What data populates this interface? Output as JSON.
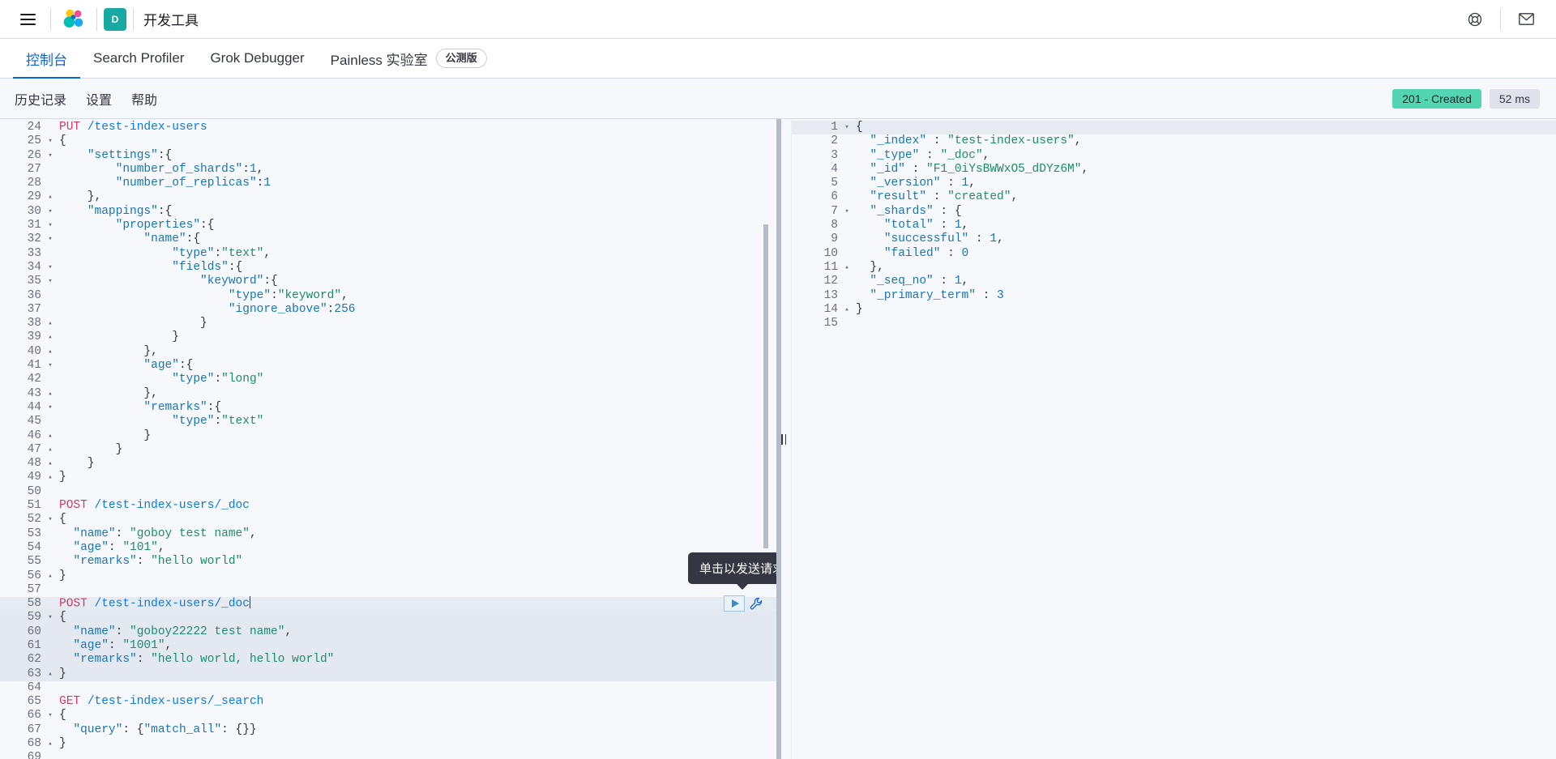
{
  "header": {
    "menu_icon": "hamburger-menu-icon",
    "logo_icon": "elastic-logo-icon",
    "space_avatar_label": "D",
    "app_title": "开发工具",
    "help_icon": "help-lifering-icon",
    "mail_icon": "mail-envelope-icon"
  },
  "app_tabs": [
    {
      "label": "控制台",
      "active": true
    },
    {
      "label": "Search Profiler",
      "active": false
    },
    {
      "label": "Grok Debugger",
      "active": false
    },
    {
      "label": "Painless 实验室",
      "active": false,
      "badge": "公测版"
    }
  ],
  "console_toolbar": {
    "links": [
      {
        "label": "历史记录"
      },
      {
        "label": "设置"
      },
      {
        "label": "帮助"
      }
    ],
    "status_badge": "201 - Created",
    "time_badge": "52 ms",
    "status_color": "#54d5b2",
    "time_color": "#dfe2ea"
  },
  "tooltip": {
    "text": "单击以发送请求"
  },
  "run_action": {
    "play_icon": "play-triangle-icon",
    "wrench_icon": "wrench-icon"
  },
  "editor": {
    "first_visible_line": 24,
    "lines": [
      {
        "n": 24,
        "fold": "",
        "tokens": [
          {
            "t": "PUT ",
            "c": "kw-method"
          },
          {
            "t": "/test-index-users",
            "c": "kw-url"
          }
        ]
      },
      {
        "n": 25,
        "fold": "▾",
        "tokens": [
          {
            "t": "{",
            "c": "punc"
          }
        ]
      },
      {
        "n": 26,
        "fold": "▾",
        "tokens": [
          {
            "t": "    ",
            "c": "plain"
          },
          {
            "t": "\"settings\"",
            "c": "key"
          },
          {
            "t": ":{",
            "c": "punc"
          }
        ]
      },
      {
        "n": 27,
        "fold": "",
        "tokens": [
          {
            "t": "        ",
            "c": "plain"
          },
          {
            "t": "\"number_of_shards\"",
            "c": "key"
          },
          {
            "t": ":",
            "c": "punc"
          },
          {
            "t": "1",
            "c": "num"
          },
          {
            "t": ",",
            "c": "punc"
          }
        ]
      },
      {
        "n": 28,
        "fold": "",
        "tokens": [
          {
            "t": "        ",
            "c": "plain"
          },
          {
            "t": "\"number_of_replicas\"",
            "c": "key"
          },
          {
            "t": ":",
            "c": "punc"
          },
          {
            "t": "1",
            "c": "num"
          }
        ]
      },
      {
        "n": 29,
        "fold": "▴",
        "tokens": [
          {
            "t": "    },",
            "c": "punc"
          }
        ]
      },
      {
        "n": 30,
        "fold": "▾",
        "tokens": [
          {
            "t": "    ",
            "c": "plain"
          },
          {
            "t": "\"mappings\"",
            "c": "key"
          },
          {
            "t": ":{",
            "c": "punc"
          }
        ]
      },
      {
        "n": 31,
        "fold": "▾",
        "tokens": [
          {
            "t": "        ",
            "c": "plain"
          },
          {
            "t": "\"properties\"",
            "c": "key"
          },
          {
            "t": ":{",
            "c": "punc"
          }
        ]
      },
      {
        "n": 32,
        "fold": "▾",
        "tokens": [
          {
            "t": "            ",
            "c": "plain"
          },
          {
            "t": "\"name\"",
            "c": "key"
          },
          {
            "t": ":{",
            "c": "punc"
          }
        ]
      },
      {
        "n": 33,
        "fold": "",
        "tokens": [
          {
            "t": "                ",
            "c": "plain"
          },
          {
            "t": "\"type\"",
            "c": "key"
          },
          {
            "t": ":",
            "c": "punc"
          },
          {
            "t": "\"text\"",
            "c": "str"
          },
          {
            "t": ",",
            "c": "punc"
          }
        ]
      },
      {
        "n": 34,
        "fold": "▾",
        "tokens": [
          {
            "t": "                ",
            "c": "plain"
          },
          {
            "t": "\"fields\"",
            "c": "key"
          },
          {
            "t": ":{",
            "c": "punc"
          }
        ]
      },
      {
        "n": 35,
        "fold": "▾",
        "tokens": [
          {
            "t": "                    ",
            "c": "plain"
          },
          {
            "t": "\"keyword\"",
            "c": "key"
          },
          {
            "t": ":{",
            "c": "punc"
          }
        ]
      },
      {
        "n": 36,
        "fold": "",
        "tokens": [
          {
            "t": "                        ",
            "c": "plain"
          },
          {
            "t": "\"type\"",
            "c": "key"
          },
          {
            "t": ":",
            "c": "punc"
          },
          {
            "t": "\"keyword\"",
            "c": "str"
          },
          {
            "t": ",",
            "c": "punc"
          }
        ]
      },
      {
        "n": 37,
        "fold": "",
        "tokens": [
          {
            "t": "                        ",
            "c": "plain"
          },
          {
            "t": "\"ignore_above\"",
            "c": "key"
          },
          {
            "t": ":",
            "c": "punc"
          },
          {
            "t": "256",
            "c": "num"
          }
        ]
      },
      {
        "n": 38,
        "fold": "▴",
        "tokens": [
          {
            "t": "                    }",
            "c": "punc"
          }
        ]
      },
      {
        "n": 39,
        "fold": "▴",
        "tokens": [
          {
            "t": "                }",
            "c": "punc"
          }
        ]
      },
      {
        "n": 40,
        "fold": "▴",
        "tokens": [
          {
            "t": "            },",
            "c": "punc"
          }
        ]
      },
      {
        "n": 41,
        "fold": "▾",
        "tokens": [
          {
            "t": "            ",
            "c": "plain"
          },
          {
            "t": "\"age\"",
            "c": "key"
          },
          {
            "t": ":{",
            "c": "punc"
          }
        ]
      },
      {
        "n": 42,
        "fold": "",
        "tokens": [
          {
            "t": "                ",
            "c": "plain"
          },
          {
            "t": "\"type\"",
            "c": "key"
          },
          {
            "t": ":",
            "c": "punc"
          },
          {
            "t": "\"long\"",
            "c": "str"
          }
        ]
      },
      {
        "n": 43,
        "fold": "▴",
        "tokens": [
          {
            "t": "            },",
            "c": "punc"
          }
        ]
      },
      {
        "n": 44,
        "fold": "▾",
        "tokens": [
          {
            "t": "            ",
            "c": "plain"
          },
          {
            "t": "\"remarks\"",
            "c": "key"
          },
          {
            "t": ":{",
            "c": "punc"
          }
        ]
      },
      {
        "n": 45,
        "fold": "",
        "tokens": [
          {
            "t": "                ",
            "c": "plain"
          },
          {
            "t": "\"type\"",
            "c": "key"
          },
          {
            "t": ":",
            "c": "punc"
          },
          {
            "t": "\"text\"",
            "c": "str"
          }
        ]
      },
      {
        "n": 46,
        "fold": "▴",
        "tokens": [
          {
            "t": "            }",
            "c": "punc"
          }
        ]
      },
      {
        "n": 47,
        "fold": "▴",
        "tokens": [
          {
            "t": "        }",
            "c": "punc"
          }
        ]
      },
      {
        "n": 48,
        "fold": "▴",
        "tokens": [
          {
            "t": "    }",
            "c": "punc"
          }
        ]
      },
      {
        "n": 49,
        "fold": "▴",
        "tokens": [
          {
            "t": "}",
            "c": "punc"
          }
        ]
      },
      {
        "n": 50,
        "fold": "",
        "tokens": []
      },
      {
        "n": 51,
        "fold": "",
        "tokens": [
          {
            "t": "POST ",
            "c": "kw-method"
          },
          {
            "t": "/test-index-users/_doc",
            "c": "kw-url"
          }
        ]
      },
      {
        "n": 52,
        "fold": "▾",
        "tokens": [
          {
            "t": "{",
            "c": "punc"
          }
        ]
      },
      {
        "n": 53,
        "fold": "",
        "tokens": [
          {
            "t": "  ",
            "c": "plain"
          },
          {
            "t": "\"name\"",
            "c": "key"
          },
          {
            "t": ": ",
            "c": "punc"
          },
          {
            "t": "\"goboy test name\"",
            "c": "str"
          },
          {
            "t": ",",
            "c": "punc"
          }
        ]
      },
      {
        "n": 54,
        "fold": "",
        "tokens": [
          {
            "t": "  ",
            "c": "plain"
          },
          {
            "t": "\"age\"",
            "c": "key"
          },
          {
            "t": ": ",
            "c": "punc"
          },
          {
            "t": "\"101\"",
            "c": "str"
          },
          {
            "t": ",",
            "c": "punc"
          }
        ]
      },
      {
        "n": 55,
        "fold": "",
        "tokens": [
          {
            "t": "  ",
            "c": "plain"
          },
          {
            "t": "\"remarks\"",
            "c": "key"
          },
          {
            "t": ": ",
            "c": "punc"
          },
          {
            "t": "\"hello world\"",
            "c": "str"
          }
        ]
      },
      {
        "n": 56,
        "fold": "▴",
        "tokens": [
          {
            "t": "}",
            "c": "punc"
          }
        ]
      },
      {
        "n": 57,
        "fold": "",
        "tokens": []
      },
      {
        "n": 58,
        "fold": "",
        "active": true,
        "cursor": true,
        "tokens": [
          {
            "t": "POST ",
            "c": "kw-method"
          },
          {
            "t": "/test-index-users/_doc",
            "c": "kw-url"
          }
        ]
      },
      {
        "n": 59,
        "fold": "▾",
        "selected": true,
        "tokens": [
          {
            "t": "{",
            "c": "punc"
          }
        ]
      },
      {
        "n": 60,
        "fold": "",
        "selected": true,
        "tokens": [
          {
            "t": "  ",
            "c": "plain"
          },
          {
            "t": "\"name\"",
            "c": "key"
          },
          {
            "t": ": ",
            "c": "punc"
          },
          {
            "t": "\"goboy22222 test name\"",
            "c": "str"
          },
          {
            "t": ",",
            "c": "punc"
          }
        ]
      },
      {
        "n": 61,
        "fold": "",
        "selected": true,
        "tokens": [
          {
            "t": "  ",
            "c": "plain"
          },
          {
            "t": "\"age\"",
            "c": "key"
          },
          {
            "t": ": ",
            "c": "punc"
          },
          {
            "t": "\"1001\"",
            "c": "str"
          },
          {
            "t": ",",
            "c": "punc"
          }
        ]
      },
      {
        "n": 62,
        "fold": "",
        "selected": true,
        "tokens": [
          {
            "t": "  ",
            "c": "plain"
          },
          {
            "t": "\"remarks\"",
            "c": "key"
          },
          {
            "t": ": ",
            "c": "punc"
          },
          {
            "t": "\"hello world, hello world\"",
            "c": "str"
          }
        ]
      },
      {
        "n": 63,
        "fold": "▴",
        "selected": true,
        "tokens": [
          {
            "t": "}",
            "c": "punc"
          }
        ]
      },
      {
        "n": 64,
        "fold": "",
        "tokens": []
      },
      {
        "n": 65,
        "fold": "",
        "tokens": [
          {
            "t": "GET ",
            "c": "kw-method"
          },
          {
            "t": "/test-index-users/_search",
            "c": "kw-url"
          }
        ]
      },
      {
        "n": 66,
        "fold": "▾",
        "tokens": [
          {
            "t": "{",
            "c": "punc"
          }
        ]
      },
      {
        "n": 67,
        "fold": "",
        "tokens": [
          {
            "t": "  ",
            "c": "plain"
          },
          {
            "t": "\"query\"",
            "c": "key"
          },
          {
            "t": ": {",
            "c": "punc"
          },
          {
            "t": "\"match_all\"",
            "c": "key"
          },
          {
            "t": ": {}}",
            "c": "punc"
          }
        ]
      },
      {
        "n": 68,
        "fold": "▴",
        "tokens": [
          {
            "t": "}",
            "c": "punc"
          }
        ]
      },
      {
        "n": 69,
        "fold": "",
        "tokens": []
      }
    ]
  },
  "response": {
    "lines": [
      {
        "n": 1,
        "fold": "▾",
        "active": true,
        "tokens": [
          {
            "t": "{",
            "c": "punc"
          }
        ]
      },
      {
        "n": 2,
        "fold": "",
        "tokens": [
          {
            "t": "  ",
            "c": "plain"
          },
          {
            "t": "\"_index\"",
            "c": "key"
          },
          {
            "t": " : ",
            "c": "punc"
          },
          {
            "t": "\"test-index-users\"",
            "c": "str"
          },
          {
            "t": ",",
            "c": "punc"
          }
        ]
      },
      {
        "n": 3,
        "fold": "",
        "tokens": [
          {
            "t": "  ",
            "c": "plain"
          },
          {
            "t": "\"_type\"",
            "c": "key"
          },
          {
            "t": " : ",
            "c": "punc"
          },
          {
            "t": "\"_doc\"",
            "c": "str"
          },
          {
            "t": ",",
            "c": "punc"
          }
        ]
      },
      {
        "n": 4,
        "fold": "",
        "tokens": [
          {
            "t": "  ",
            "c": "plain"
          },
          {
            "t": "\"_id\"",
            "c": "key"
          },
          {
            "t": " : ",
            "c": "punc"
          },
          {
            "t": "\"F1_0iYsBWWxO5_dDYz6M\"",
            "c": "str"
          },
          {
            "t": ",",
            "c": "punc"
          }
        ]
      },
      {
        "n": 5,
        "fold": "",
        "tokens": [
          {
            "t": "  ",
            "c": "plain"
          },
          {
            "t": "\"_version\"",
            "c": "key"
          },
          {
            "t": " : ",
            "c": "punc"
          },
          {
            "t": "1",
            "c": "num"
          },
          {
            "t": ",",
            "c": "punc"
          }
        ]
      },
      {
        "n": 6,
        "fold": "",
        "tokens": [
          {
            "t": "  ",
            "c": "plain"
          },
          {
            "t": "\"result\"",
            "c": "key"
          },
          {
            "t": " : ",
            "c": "punc"
          },
          {
            "t": "\"created\"",
            "c": "str"
          },
          {
            "t": ",",
            "c": "punc"
          }
        ]
      },
      {
        "n": 7,
        "fold": "▾",
        "tokens": [
          {
            "t": "  ",
            "c": "plain"
          },
          {
            "t": "\"_shards\"",
            "c": "key"
          },
          {
            "t": " : {",
            "c": "punc"
          }
        ]
      },
      {
        "n": 8,
        "fold": "",
        "tokens": [
          {
            "t": "    ",
            "c": "plain"
          },
          {
            "t": "\"total\"",
            "c": "key"
          },
          {
            "t": " : ",
            "c": "punc"
          },
          {
            "t": "1",
            "c": "num"
          },
          {
            "t": ",",
            "c": "punc"
          }
        ]
      },
      {
        "n": 9,
        "fold": "",
        "tokens": [
          {
            "t": "    ",
            "c": "plain"
          },
          {
            "t": "\"successful\"",
            "c": "key"
          },
          {
            "t": " : ",
            "c": "punc"
          },
          {
            "t": "1",
            "c": "num"
          },
          {
            "t": ",",
            "c": "punc"
          }
        ]
      },
      {
        "n": 10,
        "fold": "",
        "tokens": [
          {
            "t": "    ",
            "c": "plain"
          },
          {
            "t": "\"failed\"",
            "c": "key"
          },
          {
            "t": " : ",
            "c": "punc"
          },
          {
            "t": "0",
            "c": "num"
          }
        ]
      },
      {
        "n": 11,
        "fold": "▴",
        "tokens": [
          {
            "t": "  },",
            "c": "punc"
          }
        ]
      },
      {
        "n": 12,
        "fold": "",
        "tokens": [
          {
            "t": "  ",
            "c": "plain"
          },
          {
            "t": "\"_seq_no\"",
            "c": "key"
          },
          {
            "t": " : ",
            "c": "punc"
          },
          {
            "t": "1",
            "c": "num"
          },
          {
            "t": ",",
            "c": "punc"
          }
        ]
      },
      {
        "n": 13,
        "fold": "",
        "tokens": [
          {
            "t": "  ",
            "c": "plain"
          },
          {
            "t": "\"_primary_term\"",
            "c": "key"
          },
          {
            "t": " : ",
            "c": "punc"
          },
          {
            "t": "3",
            "c": "num"
          }
        ]
      },
      {
        "n": 14,
        "fold": "▴",
        "tokens": [
          {
            "t": "}",
            "c": "punc"
          }
        ]
      },
      {
        "n": 15,
        "fold": "",
        "tokens": []
      }
    ]
  }
}
